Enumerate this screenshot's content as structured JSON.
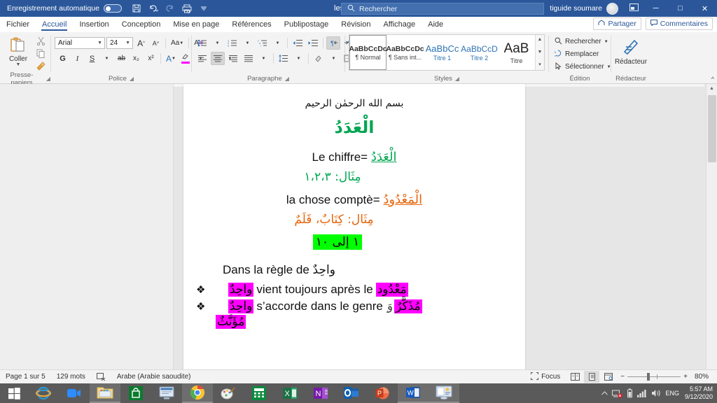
{
  "titlebar": {
    "autosave_label": "Enregistrement automatique",
    "autosave_state": "off",
    "quick_access": [
      "save-icon",
      "undo-icon",
      "redo-icon",
      "print-preview-icon",
      "customize-qat-icon"
    ],
    "document_title": "les nombres",
    "search_placeholder": "Rechercher",
    "user_name": "tiguide soumare",
    "window_buttons": {
      "minimize": "─",
      "maximize": "□",
      "close": "✕"
    }
  },
  "tabs": [
    {
      "label": "Fichier",
      "active": false
    },
    {
      "label": "Accueil",
      "active": true
    },
    {
      "label": "Insertion",
      "active": false
    },
    {
      "label": "Conception",
      "active": false
    },
    {
      "label": "Mise en page",
      "active": false
    },
    {
      "label": "Références",
      "active": false
    },
    {
      "label": "Publipostage",
      "active": false
    },
    {
      "label": "Révision",
      "active": false
    },
    {
      "label": "Affichage",
      "active": false
    },
    {
      "label": "Aide",
      "active": false
    }
  ],
  "tabstrip_right": {
    "share_label": "Partager",
    "comments_label": "Commentaires"
  },
  "ribbon": {
    "clipboard": {
      "group_label": "Presse-papiers",
      "paste_label": "Coller",
      "cut_label": "Couper",
      "copy_label": "Copier",
      "format_painter_label": "Reproduire la mise en forme"
    },
    "font": {
      "group_label": "Police",
      "font_name": "Arial",
      "font_size": "24",
      "grow_label": "A",
      "shrink_label": "A",
      "change_case_label": "Aa",
      "clear_format_label": "A",
      "bold_label": "G",
      "italic_label": "I",
      "underline_label": "S",
      "strikethrough_label": "ab",
      "subscript_label": "x₂",
      "superscript_label": "x²",
      "text_effects_label": "A",
      "highlight_label": "A",
      "font_color_label": "A",
      "highlight_color": "#ff00ff",
      "font_color": "#000000"
    },
    "paragraph": {
      "group_label": "Paragraphe",
      "bullets_label": "Puces",
      "numbering_label": "Numérotation",
      "multilevel_label": "Liste à plusieurs niveaux",
      "decrease_indent_label": "Diminuer le retrait",
      "increase_indent_label": "Augmenter le retrait",
      "rtl_label": "Texte de droite à gauche",
      "ltr_label": "Texte de gauche à droite",
      "sort_label": "Trier",
      "show_marks_label": "¶",
      "align_left_label": "Aligner à gauche",
      "align_center_label": "Centrer",
      "align_right_label": "Aligner à droite",
      "justify_label": "Justifier",
      "line_spacing_label": "Interligne",
      "shading_label": "Trame de fond",
      "borders_label": "Bordures"
    },
    "styles": {
      "group_label": "Styles",
      "items": [
        {
          "preview": "AaBbCcDc",
          "name": "¶ Normal",
          "selected": true,
          "color": "#333333"
        },
        {
          "preview": "AaBbCcDc",
          "name": "¶ Sans int...",
          "selected": false,
          "color": "#333333"
        },
        {
          "preview": "AaBbCc",
          "name": "Titre 1",
          "selected": false,
          "color": "#2e74b5"
        },
        {
          "preview": "AaBbCcD",
          "name": "Titre 2",
          "selected": false,
          "color": "#2e74b5"
        },
        {
          "preview": "AaB",
          "name": "Titre",
          "selected": false,
          "color": "#222222"
        }
      ]
    },
    "edition": {
      "group_label": "Édition",
      "find_label": "Rechercher",
      "replace_label": "Remplacer",
      "select_label": "Sélectionner"
    },
    "editor": {
      "group_label": "Rédacteur",
      "button_label": "Rédacteur"
    },
    "collapse_label": "^"
  },
  "document": {
    "bismillah": "بسم الله الرحمٰن الرحيم",
    "title": "الْعَدَدُ",
    "lines": [
      {
        "id": "chiffre",
        "fr": "Le chiffre=",
        "ar": "الْعَدَدُ",
        "ar_style": "green-underline"
      },
      {
        "id": "exemple1",
        "ar": "مِثَال: ١،٢،٣",
        "ar_style": "green"
      },
      {
        "id": "chose-comptee",
        "fr": "la chose comptè=",
        "ar": "الْمَعْدُودُ",
        "ar_style": "orange-underline"
      },
      {
        "id": "exemple2",
        "ar": "مِثَال: كِتَابٌ، قَلَمٌ",
        "ar_style": "orange"
      },
      {
        "id": "range",
        "ar": "١ إلى ١٠",
        "ar_style": "highlight-green"
      },
      {
        "id": "regle",
        "fr": "Dans la règle de",
        "ar": "واحِدٌ",
        "ar_style": "plain"
      }
    ],
    "bullets": [
      {
        "marker": "❖",
        "ar_start": "واحِدٌ",
        "fr": "vient toujours après le",
        "ar_end": "مَعْدُود",
        "highlight": "#ff00ff"
      },
      {
        "marker": "❖",
        "ar_start": "واحِدٌ",
        "fr": "s’accorde dans le genre",
        "ar_end_1": "وَ",
        "ar_end_2": "مُذَكَّرٌ",
        "ar_end_3": "مُؤَنَّثٌ",
        "highlight": "#ff00ff"
      }
    ]
  },
  "statusbar": {
    "page_label": "Page 1 sur 5",
    "word_count": "129 mots",
    "proofing_icon": "spellcheck-icon",
    "language": "Arabe (Arabie saoudite)",
    "focus_label": "Focus",
    "views": [
      "read-mode-icon",
      "print-layout-icon",
      "web-layout-icon"
    ],
    "active_view": "print-layout-icon",
    "zoom_out": "−",
    "zoom_in": "+",
    "zoom_level": "80%"
  },
  "taskbar": {
    "start_label": "start-icon",
    "items": [
      {
        "name": "internet-explorer-icon",
        "running": false
      },
      {
        "name": "zoom-icon",
        "running": false
      },
      {
        "name": "file-explorer-icon",
        "running": true
      },
      {
        "name": "microsoft-store-icon",
        "running": false
      },
      {
        "name": "remote-desktop-icon",
        "running": false
      },
      {
        "name": "google-chrome-icon",
        "running": true
      },
      {
        "name": "paint-icon",
        "running": false
      },
      {
        "name": "calculator-icon",
        "running": false
      },
      {
        "name": "excel-icon",
        "running": false
      },
      {
        "name": "onenote-icon",
        "running": false
      },
      {
        "name": "outlook-icon",
        "running": false
      },
      {
        "name": "powerpoint-icon",
        "running": false
      },
      {
        "name": "word-icon",
        "running": true
      },
      {
        "name": "control-panel-icon",
        "running": true
      }
    ],
    "tray": {
      "show_hidden": "▲",
      "network_icon": "network-error-icon",
      "battery_icon": "battery-icon",
      "signal_icon": "signal-icon",
      "volume_icon": "volume-icon",
      "language": "ENG",
      "time": "5:57 AM",
      "date": "9/12/2020"
    }
  },
  "colors": {
    "word_blue": "#2b579a",
    "accent_green": "#00a651",
    "accent_orange": "#e8640a",
    "highlight_green": "#00ff00",
    "highlight_magenta": "#ff00ff"
  }
}
